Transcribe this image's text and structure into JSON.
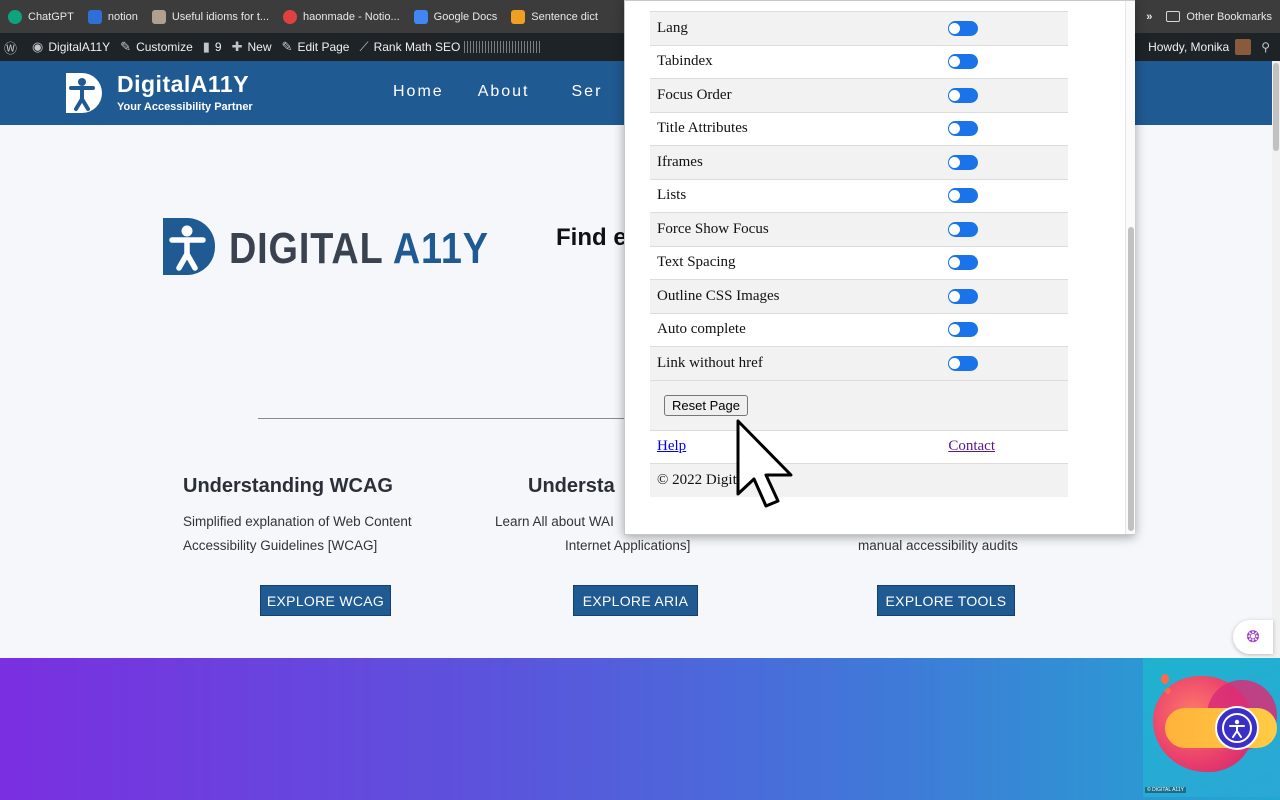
{
  "bookmarks": {
    "items": [
      {
        "label": "ChatGPT",
        "color": "#10a37f"
      },
      {
        "label": "notion",
        "color": "#2f6fd6"
      },
      {
        "label": "Useful idioms for t...",
        "color": "#b0a090"
      },
      {
        "label": "haonmade - Notio...",
        "color": "#e04040"
      },
      {
        "label": "Google Docs",
        "color": "#4285f4"
      },
      {
        "label": "Sentence dict",
        "color": "#f0a020"
      }
    ],
    "overflow": "»",
    "other": "Other Bookmarks"
  },
  "adminbar": {
    "site": "DigitalA11Y",
    "customize": "Customize",
    "comments": "9",
    "new": "New",
    "edit": "Edit Page",
    "seo": "Rank Math SEO",
    "howdy": "Howdy, Monika"
  },
  "header": {
    "title": "DigitalA11Y",
    "tagline": "Your Accessibility Partner",
    "nav": [
      "Home",
      "About",
      "Ser"
    ]
  },
  "hero": {
    "logo_main": "DIGITAL ",
    "logo_accent": "A11Y",
    "heading": "Find e"
  },
  "cards": [
    {
      "title": "Understanding WCAG",
      "desc1": "Simplified explanation of Web Content",
      "desc2": "Accessibility Guidelines [WCAG]",
      "button": "EXPLORE WCAG"
    },
    {
      "title": "Understa",
      "desc1": "Learn All about WAI",
      "desc2": "Internet Applications]",
      "button": "EXPLORE ARIA"
    },
    {
      "title": "",
      "desc1": "",
      "desc2": "manual accessibility audits",
      "button": "EXPLORE TOOLS"
    }
  ],
  "popup": {
    "rules": [
      "Lang",
      "Tabindex",
      "Focus Order",
      "Title Attributes",
      "Iframes",
      "Lists",
      "Force Show Focus",
      "Text Spacing",
      "Outline CSS Images",
      "Auto complete",
      "Link without href"
    ],
    "reset": "Reset Page",
    "help": "Help",
    "contact": "Contact",
    "copyright": "© 2022 Digit"
  },
  "widget": {
    "badge": "© DIGITAL A11Y"
  },
  "colors": {
    "brand": "#1f5a92",
    "toggle": "#1a73e8"
  }
}
